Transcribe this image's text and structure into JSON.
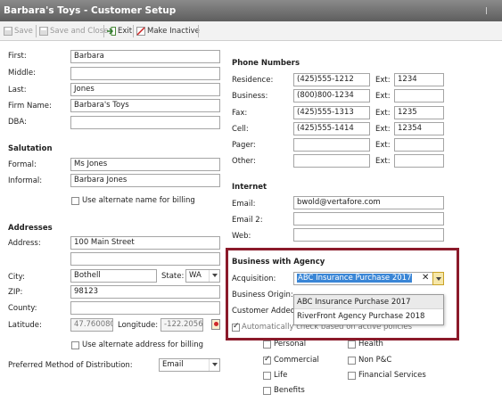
{
  "window": {
    "title": "Barbara's Toys - Customer Setup"
  },
  "toolbar": {
    "save": "Save",
    "save_close": "Save and Close",
    "exit": "Exit",
    "make_inactive": "Make Inactive"
  },
  "name": {
    "first_label": "First:",
    "first": "Barbara",
    "middle_label": "Middle:",
    "middle": "",
    "last_label": "Last:",
    "last": "Jones",
    "firm_label": "Firm Name:",
    "firm": "Barbara's Toys",
    "dba_label": "DBA:",
    "dba": ""
  },
  "salutation": {
    "header": "Salutation",
    "formal_label": "Formal:",
    "formal": "Ms Jones",
    "informal_label": "Informal:",
    "informal": "Barbara Jones",
    "alt_name_billing": "Use alternate name for billing"
  },
  "addresses": {
    "header": "Addresses",
    "address_label": "Address:",
    "address1": "100 Main Street",
    "address2": "",
    "city_label": "City:",
    "city": "Bothell",
    "state_label": "State:",
    "state": "WA",
    "zip_label": "ZIP:",
    "zip": "98123",
    "county_label": "County:",
    "county": "",
    "latitude_label": "Latitude:",
    "latitude": "47.760080",
    "longitude_label": "Longitude:",
    "longitude": "-122.20564",
    "alt_address_billing": "Use alternate address for billing"
  },
  "distribution": {
    "label": "Preferred Method of Distribution:",
    "value": "Email"
  },
  "phones": {
    "header": "Phone Numbers",
    "ext_label": "Ext:",
    "rows": [
      {
        "label": "Residence:",
        "number": "(425)555-1212",
        "ext": "1234"
      },
      {
        "label": "Business:",
        "number": "(800)800-1234",
        "ext": ""
      },
      {
        "label": "Fax:",
        "number": "(425)555-1313",
        "ext": "1235"
      },
      {
        "label": "Cell:",
        "number": "(425)555-1414",
        "ext": "12354"
      },
      {
        "label": "Pager:",
        "number": "",
        "ext": ""
      },
      {
        "label": "Other:",
        "number": "",
        "ext": ""
      }
    ]
  },
  "internet": {
    "header": "Internet",
    "email_label": "Email:",
    "email": "bwold@vertafore.com",
    "email2_label": "Email 2:",
    "email2": "",
    "web_label": "Web:",
    "web": ""
  },
  "business": {
    "header": "Business with Agency",
    "acquisition_label": "Acquisition:",
    "acquisition": "ABC Insurance Purchase 2017",
    "origin_label": "Business Origin:",
    "customer_added_label": "Customer Added D",
    "auto_check_label": "Automatically check based on active policies",
    "options": [
      "ABC Insurance Purchase 2017",
      "RiverFront Agency Purchase 2018"
    ]
  },
  "lines": {
    "personal": "Personal",
    "health": "Health",
    "commercial": "Commercial",
    "non_pc": "Non P&C",
    "life": "Life",
    "financial": "Financial Services",
    "benefits": "Benefits"
  },
  "colors": {
    "highlight_border": "#8b1a2a",
    "selection": "#3a86d6"
  }
}
